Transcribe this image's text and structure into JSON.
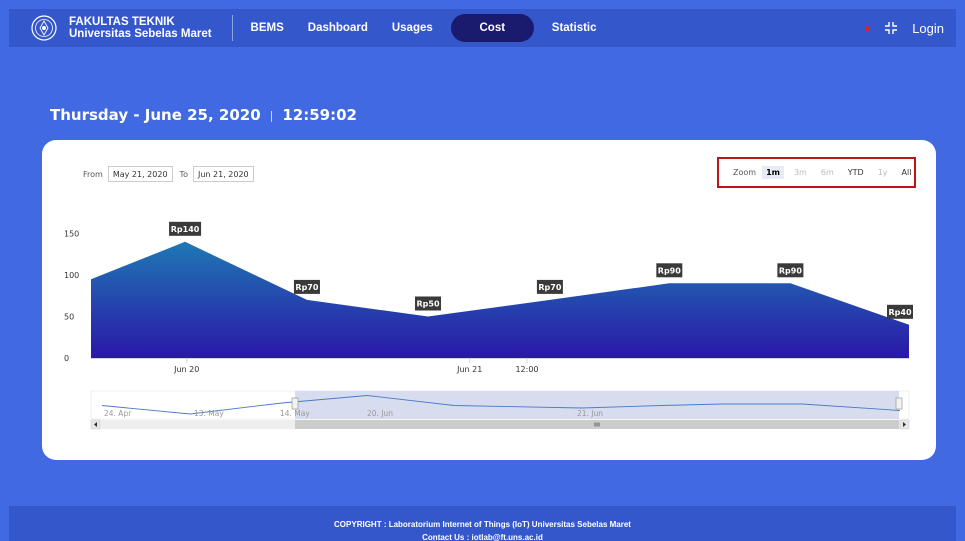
{
  "header": {
    "brand_line1": "FAKULTAS TEKNIK",
    "brand_line2": "Universitas Sebelas Maret",
    "nav": {
      "bems": "BEMS",
      "dashboard": "Dashboard",
      "usages": "Usages",
      "cost": "Cost",
      "statistic": "Statistic"
    },
    "login": "Login"
  },
  "datetime": {
    "date": "Thursday - June 25, 2020",
    "separator": "|",
    "time": "12:59:02"
  },
  "range": {
    "from_label": "From",
    "from_value": "May 21, 2020",
    "to_label": "To",
    "to_value": "Jun 21, 2020"
  },
  "zoom": {
    "label": "Zoom",
    "buttons": [
      {
        "label": "1m",
        "state": "active"
      },
      {
        "label": "3m",
        "state": "disabled"
      },
      {
        "label": "6m",
        "state": "disabled"
      },
      {
        "label": "YTD",
        "state": "enabled"
      },
      {
        "label": "1y",
        "state": "disabled"
      },
      {
        "label": "All",
        "state": "enabled"
      }
    ]
  },
  "chart_data": {
    "type": "area",
    "y_ticks": [
      "0",
      "50",
      "100",
      "150"
    ],
    "ylim": [
      0,
      160
    ],
    "x_ticks": [
      "Jun 20",
      "Jun 21",
      "12:00"
    ],
    "points": [
      {
        "x": 0.0,
        "y": 95,
        "label": ""
      },
      {
        "x": 0.115,
        "y": 140,
        "label": "Rp140"
      },
      {
        "x": 0.264,
        "y": 70,
        "label": "Rp70"
      },
      {
        "x": 0.412,
        "y": 50,
        "label": "Rp50"
      },
      {
        "x": 0.561,
        "y": 70,
        "label": "Rp70"
      },
      {
        "x": 0.707,
        "y": 90,
        "label": "Rp90"
      },
      {
        "x": 0.855,
        "y": 90,
        "label": "Rp90"
      },
      {
        "x": 1.0,
        "y": 40,
        "label": "Rp40"
      }
    ],
    "colors": {
      "area_top": "#1f78b4",
      "area_bottom": "#2a17a8",
      "label_bg": "#3a3a3a"
    },
    "navigator": {
      "labels": [
        "24. Apr",
        "13. May",
        "14. May",
        "20. Jun",
        "21. Jun"
      ],
      "series": [
        25,
        8,
        30,
        45,
        25,
        20,
        25,
        28,
        28,
        15
      ]
    }
  },
  "footer": {
    "copyright": "COPYRIGHT : Laboratorium Internet of Things (IoT) Universitas Sebelas Maret",
    "contact": "Contact Us : iotlab@ft.uns.ac.id"
  }
}
